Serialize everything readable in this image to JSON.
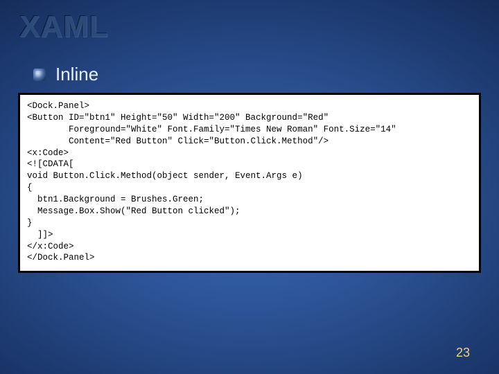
{
  "slide": {
    "title": "XAML",
    "bullet": "Inline",
    "page_number": "23"
  },
  "code": {
    "lines": [
      "<Dock.Panel>",
      "<Button ID=\"btn1\" Height=\"50\" Width=\"200\" Background=\"Red\"",
      "        Foreground=\"White\" Font.Family=\"Times New Roman\" Font.Size=\"14\"",
      "        Content=\"Red Button\" Click=\"Button.Click.Method\"/>",
      "<x:Code>",
      "<![CDATA[",
      "void Button.Click.Method(object sender, Event.Args e)",
      "{",
      "  btn1.Background = Brushes.Green;",
      "  Message.Box.Show(\"Red Button clicked\");",
      "}",
      "  ]]>",
      "</x:Code>",
      "</Dock.Panel>"
    ]
  }
}
